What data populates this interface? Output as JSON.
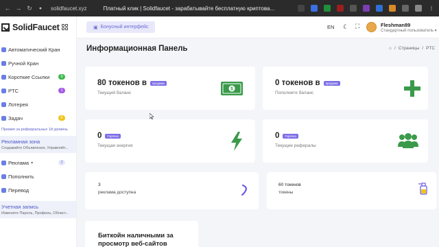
{
  "browser": {
    "url": "solidfaucet.xyz",
    "tab_title": "Платный клик | Solidfaucet - зарабатывайте бесплатную криптова..."
  },
  "sidebar": {
    "brand": "SolidFaucet",
    "items": [
      {
        "label": "Автоматический Кран"
      },
      {
        "label": "Ручной Кран"
      },
      {
        "label": "Короткие Ссылки",
        "badge": "9",
        "badge_color": "#3fb950"
      },
      {
        "label": "PTC",
        "badge": "1",
        "badge_color": "#a45be6"
      },
      {
        "label": "Лотерея"
      },
      {
        "label": "Задач",
        "badge": "6",
        "badge_color": "#f0c419"
      }
    ],
    "referral_note": "Премия за реферральных 1й уровень",
    "ad_zone": {
      "title": "Рекламная зона",
      "subtitle": "Создавайте Объявления, Управляйт..."
    },
    "items2": [
      {
        "label": "Реклама",
        "badge": "2",
        "badge_color": "#e6e8fa"
      },
      {
        "label": "Пополнить"
      },
      {
        "label": "Перевод"
      }
    ],
    "account": {
      "title": "Учетная запись",
      "subtitle": "Измените Пароль, Профиль, Област..."
    }
  },
  "topbar": {
    "bonus_label": "Бонусный интерфейс",
    "lang": "EN",
    "username": "Fleshman89",
    "role": "Стандартный пользователь"
  },
  "main": {
    "title": "Информационная Панель",
    "crumbs": [
      "Страницы",
      "PTC"
    ],
    "cards": [
      {
        "value": "80 токенов в",
        "tag": "продажи",
        "label": "Текущий баланс",
        "icon": "money-icon",
        "color": "#3a9a4a"
      },
      {
        "value": "0 токенов в",
        "tag": "продажи",
        "label": "Пополните баланс",
        "icon": "plus-icon",
        "color": "#3a9a4a"
      },
      {
        "value": "0",
        "tag": "Горячка",
        "label": "Текущая энергия",
        "icon": "bolt-icon",
        "color": "#3a9a4a"
      },
      {
        "value": "0",
        "tag": "Горячка",
        "label": "Текущие рефералы",
        "icon": "users-icon",
        "color": "#3a9a4a"
      }
    ],
    "mini_cards": [
      {
        "value": "3",
        "label": "реклама доступна"
      },
      {
        "value": "60 токенов",
        "label": "токены"
      }
    ],
    "promo": {
      "line1": "Биткойн наличными за",
      "line2": "просмотр веб-сайтов"
    }
  }
}
